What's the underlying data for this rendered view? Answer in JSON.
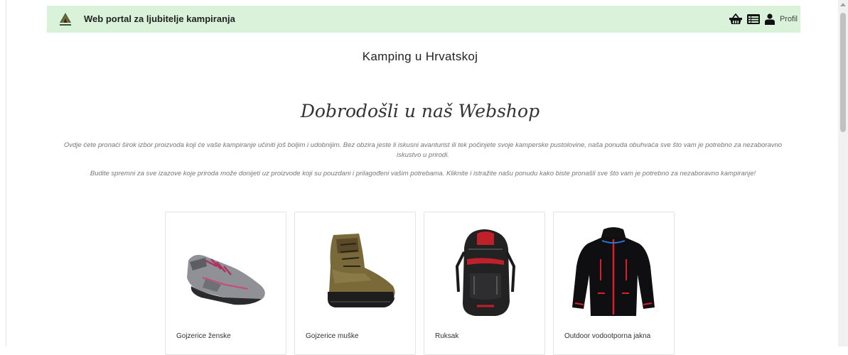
{
  "navbar": {
    "brand": "Web portal za ljubitelje kampiranja",
    "logo_icon": "camping-logo-icon",
    "icons": [
      "basket-icon",
      "list-icon",
      "user-icon"
    ],
    "profile_label": "Profil",
    "background": "#d9f2d9"
  },
  "main": {
    "title": "Kamping u Hrvatskoj",
    "welcome": "Dobrodošli u naš Webshop",
    "intro_1": "Ovdje ćete pronaći širok izbor proizvoda koji će vaše kampiranje učiniti još boljim i udobnijim. Bez obzira jeste li iskusni avanturist ili tek počinjete svoje kamperske pustolovine, naša ponuda obuhvaća sve što vam je potrebno za nezaboravno iskustvo u prirodi.",
    "intro_2": "Budite spremni za sve izazove koje priroda može donijeti uz proizvode koji su pouzdani i prilagođeni vašim potrebama. Kliknite i istražite našu ponudu kako biste pronašli sve što vam je potrebno za nezaboravno kampiranje!"
  },
  "products": [
    {
      "name": "Gojzerice ženske",
      "icon": "womens-hiking-shoe-image"
    },
    {
      "name": "Gojzerice muške",
      "icon": "mens-hiking-boot-image"
    },
    {
      "name": "Ruksak",
      "icon": "backpack-image"
    },
    {
      "name": "Outdoor vodootporna jakna",
      "icon": "waterproof-jacket-image"
    }
  ]
}
